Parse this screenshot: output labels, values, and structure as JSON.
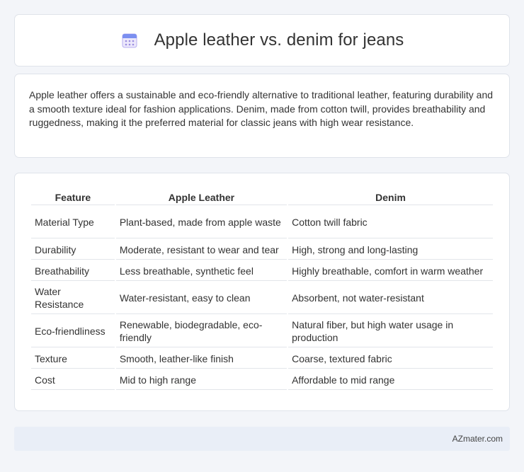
{
  "header": {
    "title": "Apple leather vs. denim for jeans",
    "icon": "calendar-icon"
  },
  "description": "Apple leather offers a sustainable and eco-friendly alternative to traditional leather, featuring durability and a smooth texture ideal for fashion applications. Denim, made from cotton twill, provides breathability and ruggedness, making it the preferred material for classic jeans with high wear resistance.",
  "table": {
    "headers": [
      "Feature",
      "Apple Leather",
      "Denim"
    ],
    "rows": [
      [
        "Material Type",
        "Plant-based, made from apple waste",
        "Cotton twill fabric"
      ],
      [
        "Durability",
        "Moderate, resistant to wear and tear",
        "High, strong and long-lasting"
      ],
      [
        "Breathability",
        "Less breathable, synthetic feel",
        "Highly breathable, comfort in warm weather"
      ],
      [
        "Water Resistance",
        "Water-resistant, easy to clean",
        "Absorbent, not water-resistant"
      ],
      [
        "Eco-friendliness",
        "Renewable, biodegradable, eco-friendly",
        "Natural fiber, but high water usage in production"
      ],
      [
        "Texture",
        "Smooth, leather-like finish",
        "Coarse, textured fabric"
      ],
      [
        "Cost",
        "Mid to high range",
        "Affordable to mid range"
      ]
    ]
  },
  "footer": {
    "brand": "AZmater.com"
  }
}
